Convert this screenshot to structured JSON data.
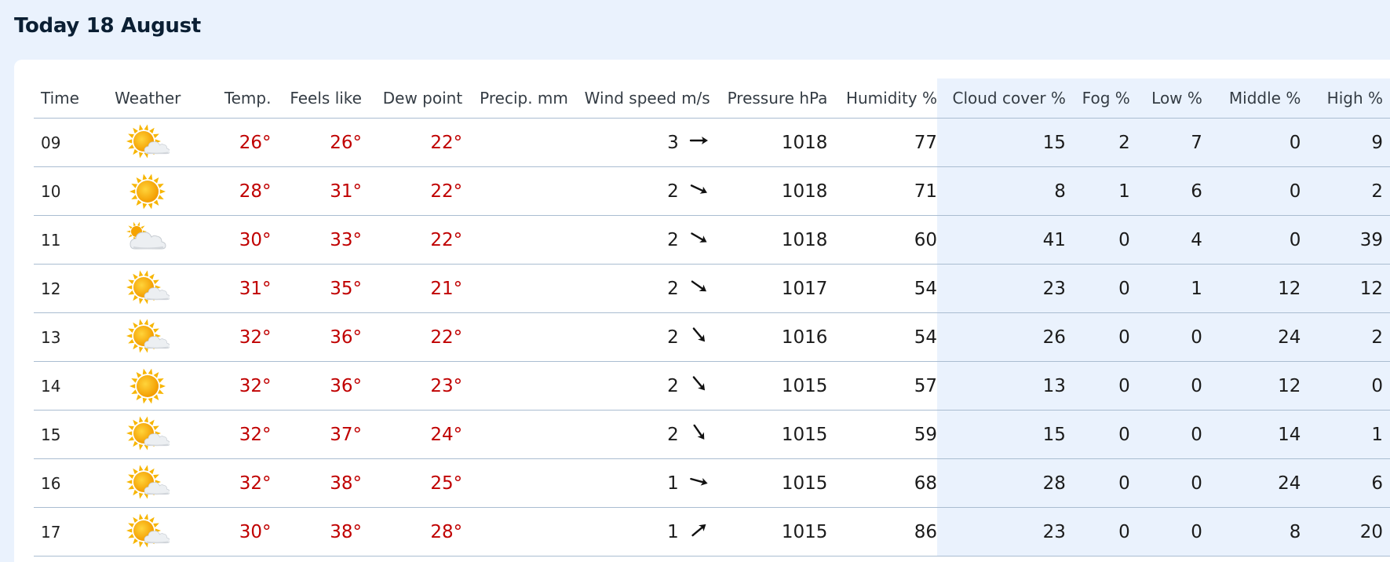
{
  "page": {
    "title": "Today 18 August"
  },
  "columns": {
    "time": "Time",
    "weather": "Weather",
    "temp": "Temp.",
    "feels": "Feels like",
    "dew": "Dew point",
    "precip": "Precip. mm",
    "wind": "Wind speed m/s",
    "pressure": "Pressure hPa",
    "humidity": "Humidity %",
    "cloud": "Cloud cover %",
    "fog": "Fog %",
    "low": "Low %",
    "middle": "Middle %",
    "high": "High %"
  },
  "rows": [
    {
      "time": "09",
      "weather_icon": "sun-cloud-icon",
      "temp": "26°",
      "feels": "26°",
      "dew": "22°",
      "precip": "",
      "wind_speed": "3",
      "wind_icon": "arrow-east-icon",
      "wind_rotation_deg": 0,
      "pressure": "1018",
      "humidity": "77",
      "cloud": "15",
      "fog": "2",
      "low": "7",
      "middle": "0",
      "high": "9"
    },
    {
      "time": "10",
      "weather_icon": "sun-icon",
      "temp": "28°",
      "feels": "31°",
      "dew": "22°",
      "precip": "",
      "wind_speed": "2",
      "wind_icon": "arrow-southeast-icon",
      "wind_rotation_deg": 25,
      "pressure": "1018",
      "humidity": "71",
      "cloud": "8",
      "fog": "1",
      "low": "6",
      "middle": "0",
      "high": "2"
    },
    {
      "time": "11",
      "weather_icon": "cloud-sun-icon",
      "temp": "30°",
      "feels": "33°",
      "dew": "22°",
      "precip": "",
      "wind_speed": "2",
      "wind_icon": "arrow-southeast-icon",
      "wind_rotation_deg": 30,
      "pressure": "1018",
      "humidity": "60",
      "cloud": "41",
      "fog": "0",
      "low": "4",
      "middle": "0",
      "high": "39"
    },
    {
      "time": "12",
      "weather_icon": "sun-cloud-icon",
      "temp": "31°",
      "feels": "35°",
      "dew": "21°",
      "precip": "",
      "wind_speed": "2",
      "wind_icon": "arrow-southeast-icon",
      "wind_rotation_deg": 35,
      "pressure": "1017",
      "humidity": "54",
      "cloud": "23",
      "fog": "0",
      "low": "1",
      "middle": "12",
      "high": "12"
    },
    {
      "time": "13",
      "weather_icon": "sun-cloud-icon",
      "temp": "32°",
      "feels": "36°",
      "dew": "22°",
      "precip": "",
      "wind_speed": "2",
      "wind_icon": "arrow-southeast-icon",
      "wind_rotation_deg": 50,
      "pressure": "1016",
      "humidity": "54",
      "cloud": "26",
      "fog": "0",
      "low": "0",
      "middle": "24",
      "high": "2"
    },
    {
      "time": "14",
      "weather_icon": "sun-icon",
      "temp": "32°",
      "feels": "36°",
      "dew": "23°",
      "precip": "",
      "wind_speed": "2",
      "wind_icon": "arrow-southeast-icon",
      "wind_rotation_deg": 50,
      "pressure": "1015",
      "humidity": "57",
      "cloud": "13",
      "fog": "0",
      "low": "0",
      "middle": "12",
      "high": "0"
    },
    {
      "time": "15",
      "weather_icon": "sun-cloud-icon",
      "temp": "32°",
      "feels": "37°",
      "dew": "24°",
      "precip": "",
      "wind_speed": "2",
      "wind_icon": "arrow-southeast-icon",
      "wind_rotation_deg": 55,
      "pressure": "1015",
      "humidity": "59",
      "cloud": "15",
      "fog": "0",
      "low": "0",
      "middle": "14",
      "high": "1"
    },
    {
      "time": "16",
      "weather_icon": "sun-cloud-icon",
      "temp": "32°",
      "feels": "38°",
      "dew": "25°",
      "precip": "",
      "wind_speed": "1",
      "wind_icon": "arrow-east-icon",
      "wind_rotation_deg": 15,
      "pressure": "1015",
      "humidity": "68",
      "cloud": "28",
      "fog": "0",
      "low": "0",
      "middle": "24",
      "high": "6"
    },
    {
      "time": "17",
      "weather_icon": "sun-cloud-icon",
      "temp": "30°",
      "feels": "38°",
      "dew": "28°",
      "precip": "",
      "wind_speed": "1",
      "wind_icon": "arrow-northeast-icon",
      "wind_rotation_deg": -40,
      "pressure": "1015",
      "humidity": "86",
      "cloud": "23",
      "fog": "0",
      "low": "0",
      "middle": "8",
      "high": "20"
    }
  ],
  "colors": {
    "temperature": "#c00000",
    "shade": "#eaf2fd",
    "divider": "#aabdd1",
    "sun": "#f7a400",
    "cloud": "#d6dadf"
  }
}
